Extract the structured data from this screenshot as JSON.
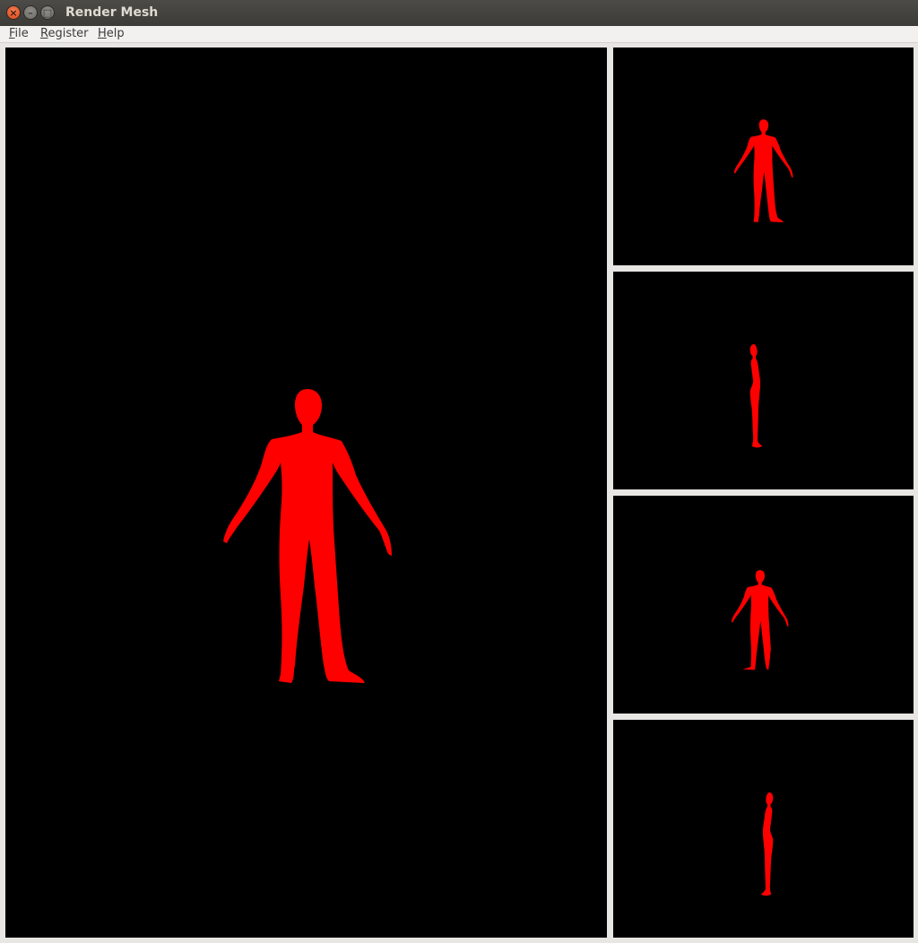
{
  "window": {
    "title": "Render Mesh",
    "close_glyph": "×",
    "minimize_glyph": "–",
    "maximize_glyph": "□"
  },
  "menu": {
    "file": {
      "mnemonic": "F",
      "rest": "ile"
    },
    "register": {
      "mnemonic": "R",
      "rest": "egister"
    },
    "help": {
      "mnemonic": "H",
      "rest": "elp"
    }
  },
  "render": {
    "background_color": "#000000",
    "mesh_color": "#ff0000",
    "views": [
      {
        "id": "main",
        "orientation": "front"
      },
      {
        "id": "view-1",
        "orientation": "front"
      },
      {
        "id": "view-2",
        "orientation": "side-left"
      },
      {
        "id": "view-3",
        "orientation": "back"
      },
      {
        "id": "view-4",
        "orientation": "side-right"
      }
    ]
  }
}
